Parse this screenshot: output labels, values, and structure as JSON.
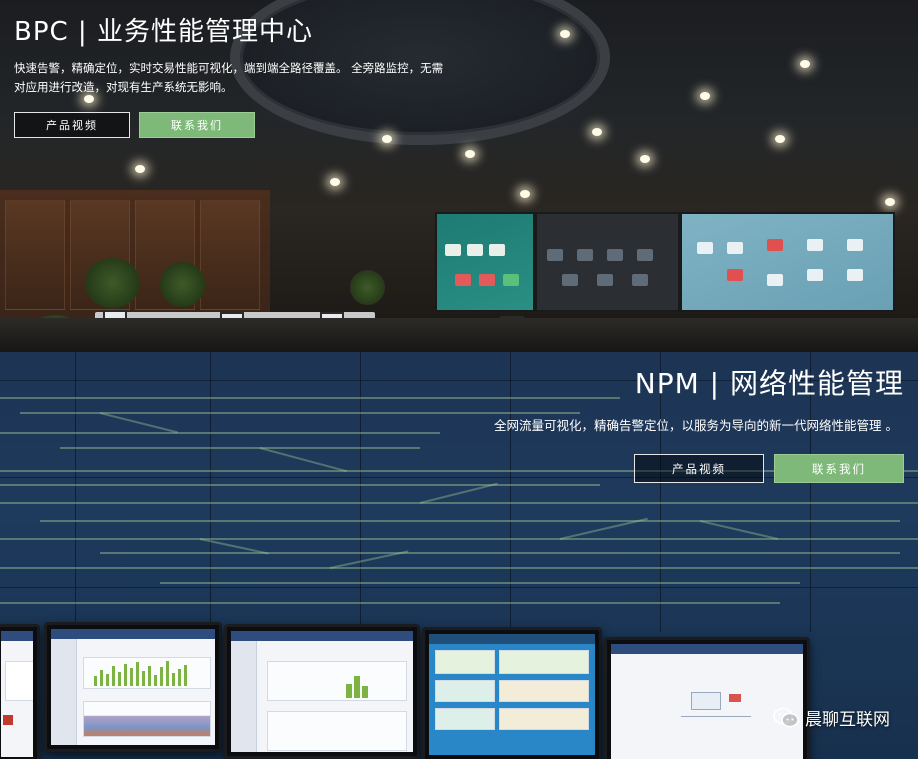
{
  "bpc": {
    "title": "BPC | 业务性能管理中心",
    "description": "快速告警，精确定位，实时交易性能可视化，端到端全路径覆盖。 全旁路监控，无需对应用进行改造，对现有生产系统无影响。",
    "video_button": "产品视频",
    "contact_button": "联系我们"
  },
  "npm": {
    "title": "NPM | 网络性能管理",
    "description": "全网流量可视化，精确告警定位，以服务为导向的新一代网络性能管理 。",
    "video_button": "产品视频",
    "contact_button": "联系我们"
  },
  "watermark": {
    "text": "晨聊互联网",
    "icon": "wechat-icon"
  },
  "colors": {
    "accent_green": "#7fb97a",
    "outline": "#e6e6e6",
    "npm_bg": "#1e3a5c"
  }
}
